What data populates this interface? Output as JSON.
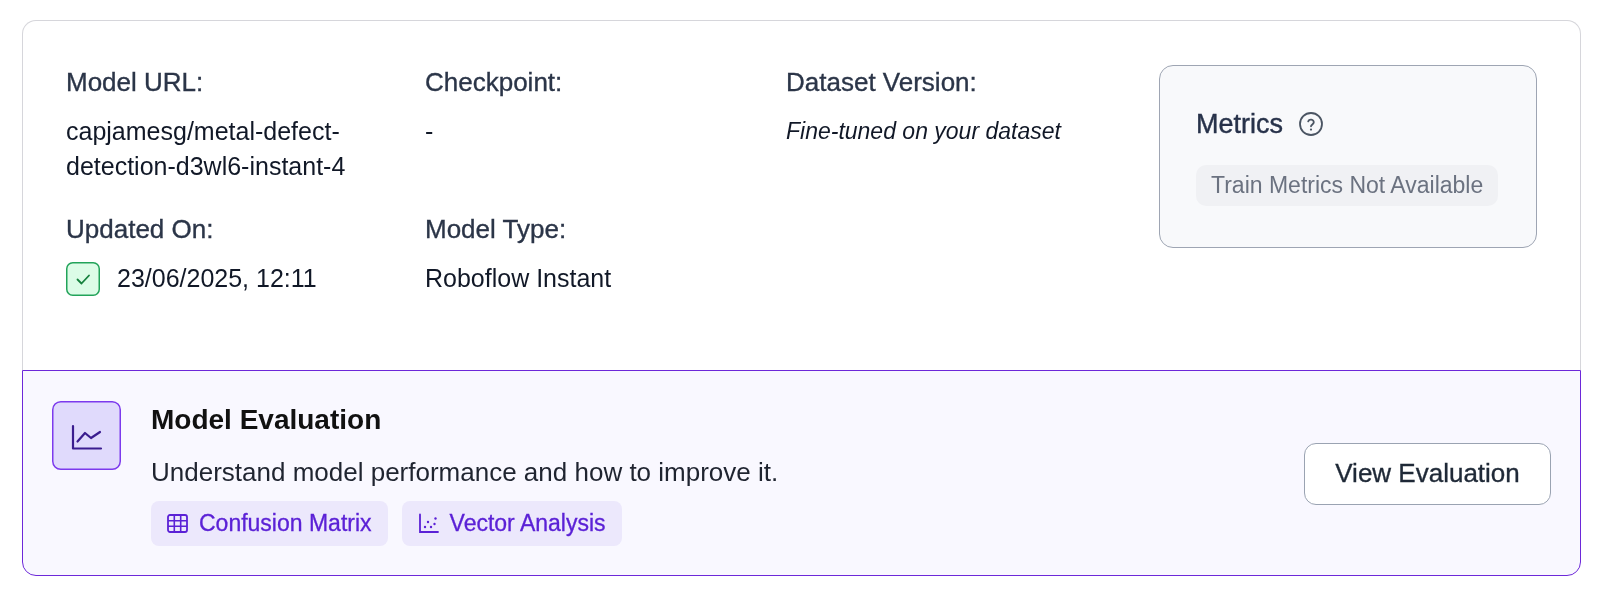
{
  "details": {
    "fields": [
      {
        "label": "Model URL:",
        "value": "capjamesg/metal-defect-detection-d3wl6-instant-4",
        "kind": "text"
      },
      {
        "label": "Checkpoint:",
        "value": "-",
        "kind": "text"
      },
      {
        "label": "Dataset Version:",
        "value": "Fine-tuned on your dataset",
        "kind": "note"
      },
      {
        "label": "Updated On:",
        "value": "23/06/2025, 12:11",
        "kind": "status"
      },
      {
        "label": "Model Type:",
        "value": "Roboflow Instant",
        "kind": "text"
      }
    ]
  },
  "metrics": {
    "title": "Metrics",
    "badge": "Train Metrics Not Available"
  },
  "evaluation": {
    "title": "Model Evaluation",
    "description": "Understand model performance and how to improve it.",
    "links": [
      {
        "label": "Confusion Matrix",
        "kind": "matrix"
      },
      {
        "label": "Vector Analysis",
        "kind": "scatter"
      }
    ],
    "button": "View Evaluation"
  }
}
